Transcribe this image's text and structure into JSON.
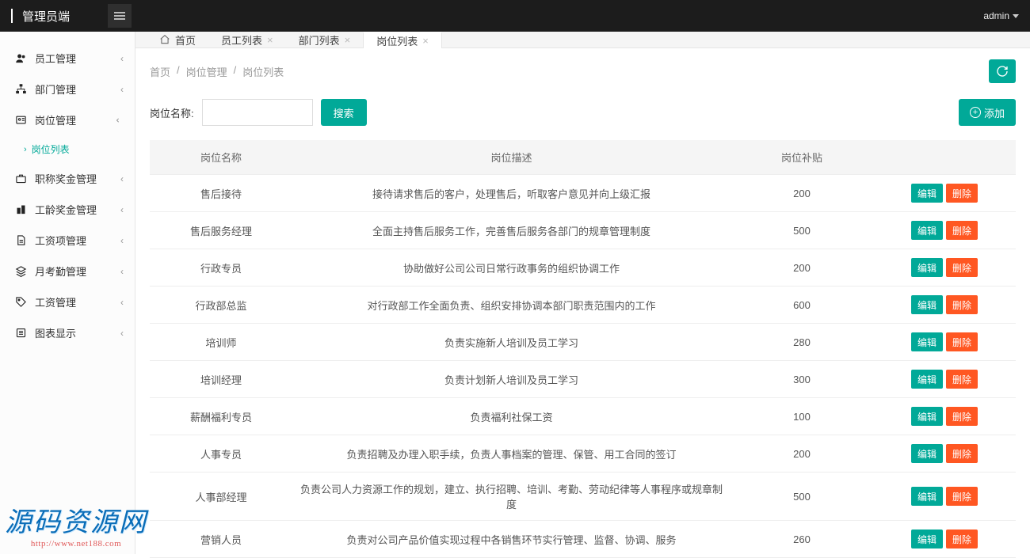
{
  "header": {
    "brand": "管理员端",
    "user": "admin"
  },
  "sidebar": {
    "items": [
      {
        "label": "员工管理",
        "icon": "users"
      },
      {
        "label": "部门管理",
        "icon": "sitemap"
      },
      {
        "label": "岗位管理",
        "icon": "id-card",
        "open": true,
        "children": [
          {
            "label": "岗位列表"
          }
        ]
      },
      {
        "label": "职称奖金管理",
        "icon": "briefcase"
      },
      {
        "label": "工龄奖金管理",
        "icon": "building"
      },
      {
        "label": "工资项管理",
        "icon": "file"
      },
      {
        "label": "月考勤管理",
        "icon": "layers"
      },
      {
        "label": "工资管理",
        "icon": "tag"
      },
      {
        "label": "图表显示",
        "icon": "list"
      }
    ]
  },
  "tabs": {
    "items": [
      {
        "label": "首页",
        "closable": false,
        "home": true
      },
      {
        "label": "员工列表",
        "closable": true
      },
      {
        "label": "部门列表",
        "closable": true
      },
      {
        "label": "岗位列表",
        "closable": true,
        "active": true
      }
    ]
  },
  "breadcrumb": {
    "parts": [
      "首页",
      "岗位管理",
      "岗位列表"
    ]
  },
  "search": {
    "label": "岗位名称:",
    "button": "搜索",
    "value": ""
  },
  "actions": {
    "add_label": "添加",
    "edit_label": "编辑",
    "delete_label": "删除"
  },
  "table": {
    "columns": [
      "岗位名称",
      "岗位描述",
      "岗位补贴",
      ""
    ],
    "rows": [
      {
        "name": "售后接待",
        "desc": "接待请求售后的客户，处理售后，听取客户意见并向上级汇报",
        "sub": "200"
      },
      {
        "name": "售后服务经理",
        "desc": "全面主持售后服务工作，完善售后服务各部门的规章管理制度",
        "sub": "500"
      },
      {
        "name": "行政专员",
        "desc": "协助做好公司公司日常行政事务的组织协调工作",
        "sub": "200"
      },
      {
        "name": "行政部总监",
        "desc": "对行政部工作全面负责、组织安排协调本部门职责范围内的工作",
        "sub": "600"
      },
      {
        "name": "培训师",
        "desc": "负责实施新人培训及员工学习",
        "sub": "280"
      },
      {
        "name": "培训经理",
        "desc": "负责计划新人培训及员工学习",
        "sub": "300"
      },
      {
        "name": "薪酬福利专员",
        "desc": "负责福利社保工资",
        "sub": "100"
      },
      {
        "name": "人事专员",
        "desc": "负责招聘及办理入职手续，负责人事档案的管理、保管、用工合同的签订",
        "sub": "200"
      },
      {
        "name": "人事部经理",
        "desc": "负责公司人力资源工作的规划，建立、执行招聘、培训、考勤、劳动纪律等人事程序或规章制度",
        "sub": "500"
      },
      {
        "name": "营销人员",
        "desc": "负责对公司产品价值实现过程中各销售环节实行管理、监督、协调、服务",
        "sub": "260"
      }
    ]
  },
  "watermark": {
    "text": "源码资源网",
    "url": "http://www.net188.com"
  }
}
